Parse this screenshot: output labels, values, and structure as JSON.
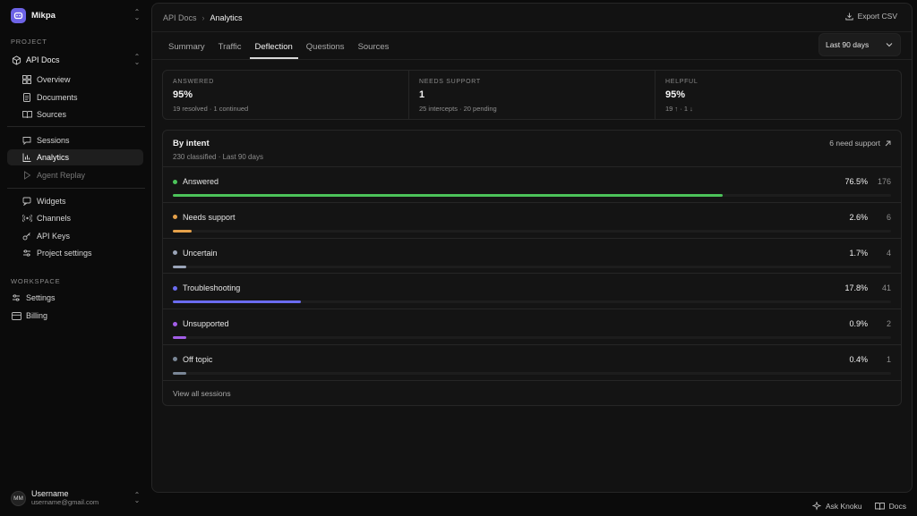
{
  "org": {
    "name": "Mikpa"
  },
  "sidebar": {
    "project_label": "PROJECT",
    "project_name": "API Docs",
    "group1": [
      {
        "label": "Overview",
        "icon": "grid-icon"
      },
      {
        "label": "Documents",
        "icon": "document-icon"
      },
      {
        "label": "Sources",
        "icon": "book-icon"
      }
    ],
    "group2": [
      {
        "label": "Sessions",
        "icon": "chat-icon"
      },
      {
        "label": "Analytics",
        "icon": "bar-chart-icon",
        "active": true
      },
      {
        "label": "Agent Replay",
        "icon": "play-icon",
        "disabled": true
      }
    ],
    "group3": [
      {
        "label": "Widgets",
        "icon": "message-square-icon"
      },
      {
        "label": "Channels",
        "icon": "broadcast-icon"
      },
      {
        "label": "API Keys",
        "icon": "key-icon"
      },
      {
        "label": "Project settings",
        "icon": "sliders-icon"
      }
    ],
    "workspace_label": "WORKSPACE",
    "workspace": [
      {
        "label": "Settings",
        "icon": "settings-sliders-icon"
      },
      {
        "label": "Billing",
        "icon": "credit-card-icon"
      }
    ],
    "user": {
      "initials": "MM",
      "name": "Username",
      "email": "username@gmail.com"
    }
  },
  "header": {
    "breadcrumb_parent": "API Docs",
    "breadcrumb_current": "Analytics",
    "export_label": "Export CSV"
  },
  "tabs": [
    {
      "label": "Summary"
    },
    {
      "label": "Traffic"
    },
    {
      "label": "Deflection",
      "active": true
    },
    {
      "label": "Questions"
    },
    {
      "label": "Sources"
    }
  ],
  "range": {
    "selected": "Last 90 days"
  },
  "stats": [
    {
      "label": "ANSWERED",
      "value": "95%",
      "sub": "19 resolved · 1 continued"
    },
    {
      "label": "NEEDS SUPPORT",
      "value": "1",
      "sub": "25 intercepts · 20 pending"
    },
    {
      "label": "HELPFUL",
      "value": "95%",
      "sub": "19 ↑ · 1 ↓"
    }
  ],
  "intent": {
    "title": "By intent",
    "subtitle": "230 classified · Last 90 days",
    "link": "6 need support",
    "view_all": "View all sessions",
    "rows": [
      {
        "label": "Answered",
        "pct": "76.5%",
        "count": "176",
        "fraction": 0.765,
        "color": "#4cc35a"
      },
      {
        "label": "Needs support",
        "pct": "2.6%",
        "count": "6",
        "fraction": 0.026,
        "color": "#e5a14a"
      },
      {
        "label": "Uncertain",
        "pct": "1.7%",
        "count": "4",
        "fraction": 0.017,
        "color": "#9aa4b8"
      },
      {
        "label": "Troubleshooting",
        "pct": "17.8%",
        "count": "41",
        "fraction": 0.178,
        "color": "#6b6cf0"
      },
      {
        "label": "Unsupported",
        "pct": "0.9%",
        "count": "2",
        "fraction": 0.009,
        "color": "#a35ee8"
      },
      {
        "label": "Off topic",
        "pct": "0.4%",
        "count": "1",
        "fraction": 0.004,
        "color": "#7a8797"
      }
    ]
  },
  "footer": {
    "ask_label": "Ask Knoku",
    "docs_label": "Docs"
  }
}
